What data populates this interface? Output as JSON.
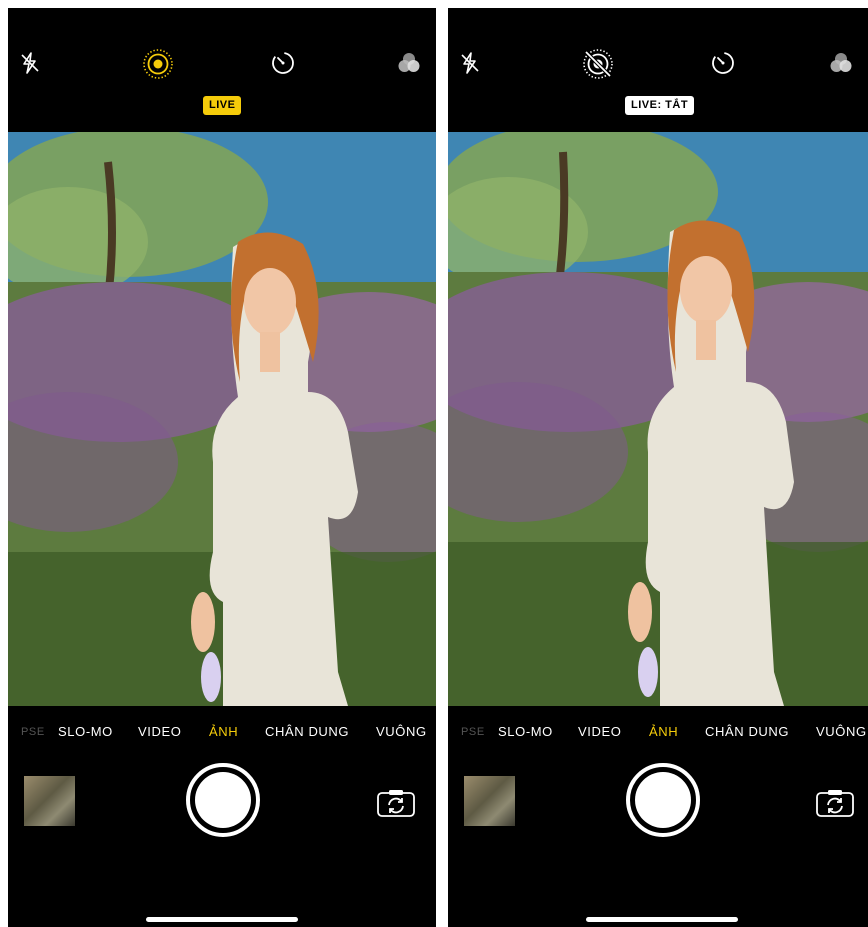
{
  "screens": [
    {
      "live_status": "LIVE",
      "live_active": true,
      "modes": [
        "PSE",
        "SLO-MO",
        "VIDEO",
        "ẢNH",
        "CHÂN DUNG",
        "VUÔNG"
      ],
      "active_mode": "ẢNH"
    },
    {
      "live_status": "LIVE: TẮT",
      "live_active": false,
      "modes": [
        "PSE",
        "SLO-MO",
        "VIDEO",
        "ẢNH",
        "CHÂN DUNG",
        "VUÔNG"
      ],
      "active_mode": "ẢNH"
    }
  ],
  "colors": {
    "live_on": "#f5cc0a",
    "live_off": "#ffffff",
    "active_mode": "#f5cc0a",
    "background": "#000000"
  },
  "icons": {
    "flash": "flash-off-icon",
    "live": "live-photo-icon",
    "timer": "timer-icon",
    "filters": "filters-icon",
    "flip": "camera-flip-icon"
  }
}
